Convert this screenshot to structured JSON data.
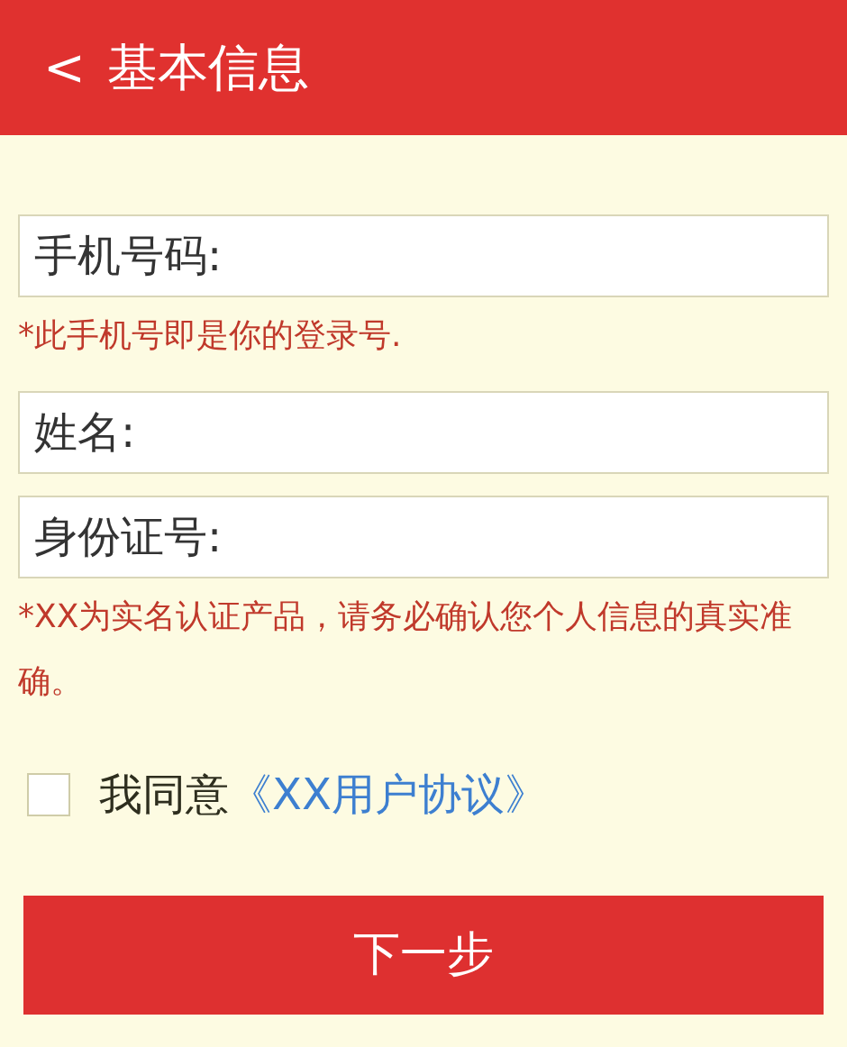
{
  "header": {
    "back": "<",
    "title": "基本信息"
  },
  "fields": [
    {
      "placeholder": "手机号码:",
      "hint": "*此手机号即是你的登录号."
    },
    {
      "placeholder": "姓名:"
    },
    {
      "placeholder": "身份证号:",
      "hint": "*XX为实名认证产品，请务必确认您个人信息的真实准确。"
    }
  ],
  "agreement": {
    "checked": false,
    "text": "我同意",
    "link": "《XX用户协议》"
  },
  "button": "下一步"
}
